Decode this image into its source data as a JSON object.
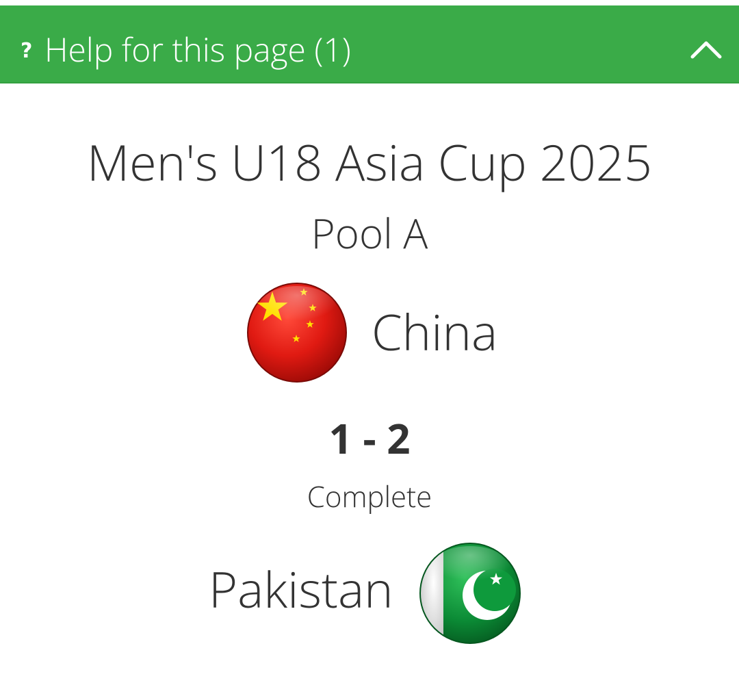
{
  "help": {
    "label": "Help for this page (1)",
    "icon": "question-icon",
    "toggle_icon": "chevron-up-icon",
    "color": "#3aab48"
  },
  "match": {
    "tournament": "Men's U18 Asia Cup 2025",
    "pool": "Pool A",
    "home_team": "China",
    "home_flag_icon": "china-flag-icon",
    "score": "1 - 2",
    "status": "Complete",
    "away_team": "Pakistan",
    "away_flag_icon": "pakistan-flag-icon"
  }
}
